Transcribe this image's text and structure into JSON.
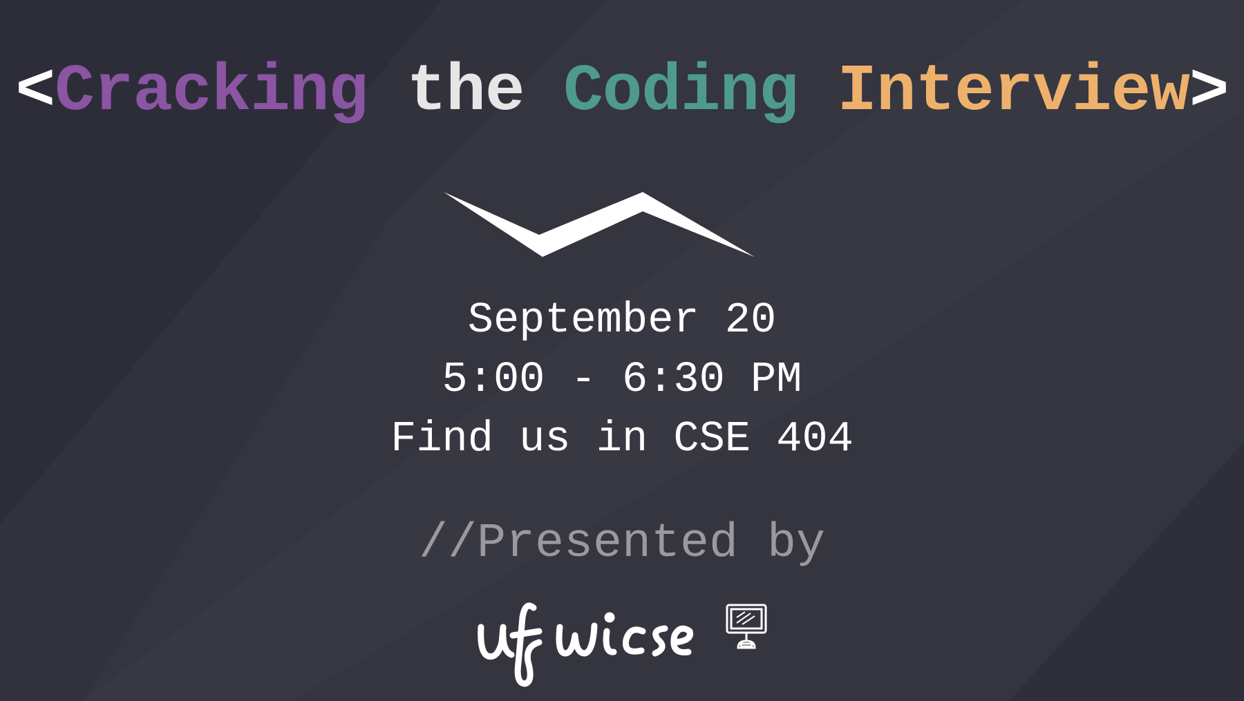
{
  "title": {
    "open_bracket": "<",
    "word1": "Cracking",
    "word2": "the",
    "word3": "Coding",
    "word4": "Interview",
    "close_bracket": ">",
    "colors": {
      "bracket": "#ffffff",
      "word1": "#8b55a3",
      "word2": "#e6e6e6",
      "word3": "#4e9a8e",
      "word4": "#eeb16c"
    }
  },
  "event": {
    "date": "September 20",
    "time": "5:00 - 6:30 PM",
    "location": "Find us in CSE 404"
  },
  "presenter": {
    "label": "//Presented by",
    "logo_text": "uf wicse",
    "logo_icon": "computer-monitor-icon"
  },
  "colors": {
    "background": "#34353f",
    "text": "#ffffff",
    "muted": "#9a9a9e"
  }
}
